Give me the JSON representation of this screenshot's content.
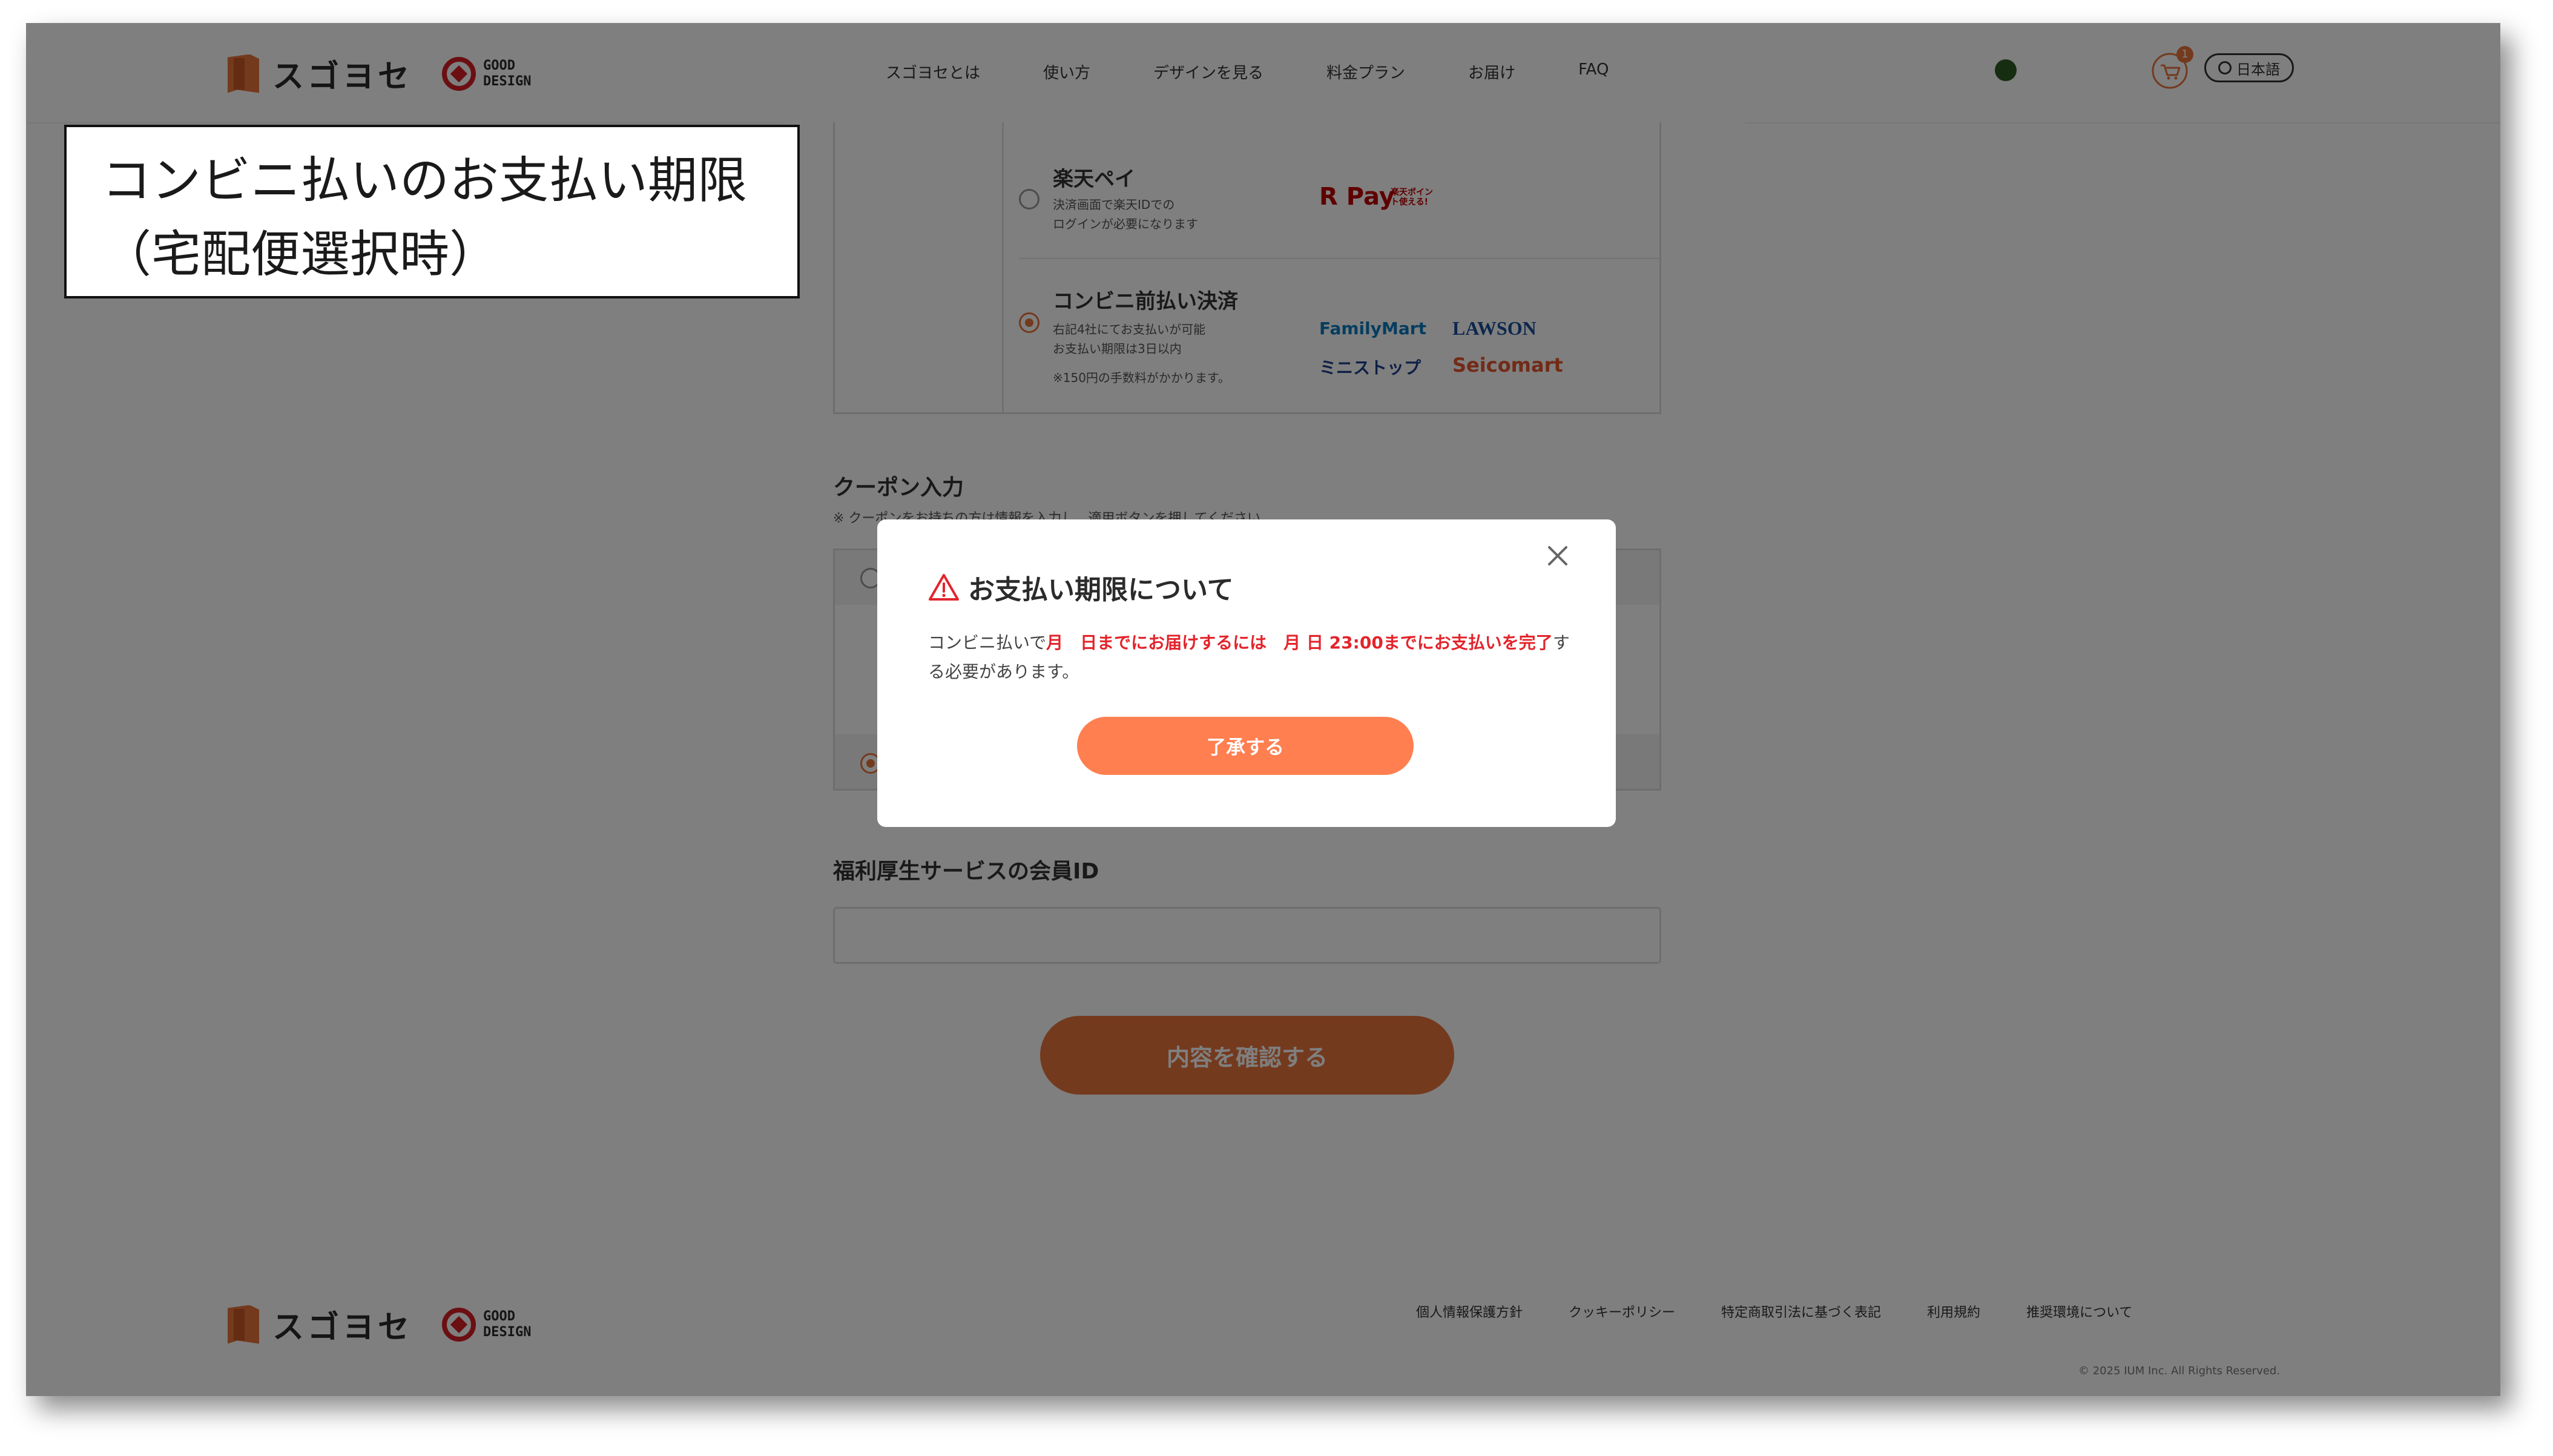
{
  "header": {
    "brand_name": "スゴヨセ",
    "good_design_line1": "GOOD",
    "good_design_line2": "DESIGN",
    "nav": [
      "スゴヨセとは",
      "使い方",
      "デザインを見る",
      "料金プラン",
      "お届け",
      "FAQ"
    ],
    "cart_count": "1",
    "language": "日本語"
  },
  "payment": {
    "rakuten_title": "楽天ペイ",
    "rakuten_note_1": "決済画面で楽天IDでの",
    "rakuten_note_2": "ログインが必要になります",
    "rakuten_brand": "R Pay",
    "rakuten_brand_sub": "楽天ポイント使える!",
    "conbini_title": "コンビニ前払い決済",
    "conbini_note_1": "右記4社にてお支払いが可能",
    "conbini_note_2": "お支払い期限は3日以内",
    "conbini_fee": "※150円の手数料がかかります。",
    "stores": [
      "FamilyMart",
      "LAWSON",
      "ミニストップ",
      "Seicomart"
    ],
    "selected": "conbini"
  },
  "coupon": {
    "title": "クーポン入力",
    "note": "※ クーポンをお持ちの方は情報を入力し、適用ボタンを押してください"
  },
  "welfare": {
    "title": "福利厚生サービスの会員ID",
    "value": ""
  },
  "confirm_label": "内容を確認する",
  "footer": {
    "links": [
      "個人情報保護方針",
      "クッキーポリシー",
      "特定商取引法に基づく表記",
      "利用規約",
      "推奨環境について"
    ],
    "copyright": "© 2025 IUM Inc. All Rights Reserved."
  },
  "modal": {
    "title": "お支払い期限について",
    "body_prefix": "コンビニ払いで",
    "body_red_1": "月　日までにお届けするには　月 日 23:00までにお支払いを完了",
    "body_suffix": "する必要があります。",
    "ok_label": "了承する"
  },
  "annotation": {
    "line1": "コンビニ払いのお支払い期限",
    "line2": "（宅配便選択時）"
  },
  "colors": {
    "accent": "#e8743c",
    "modal_button": "#ff7f50",
    "alert_red": "#e3242b"
  }
}
